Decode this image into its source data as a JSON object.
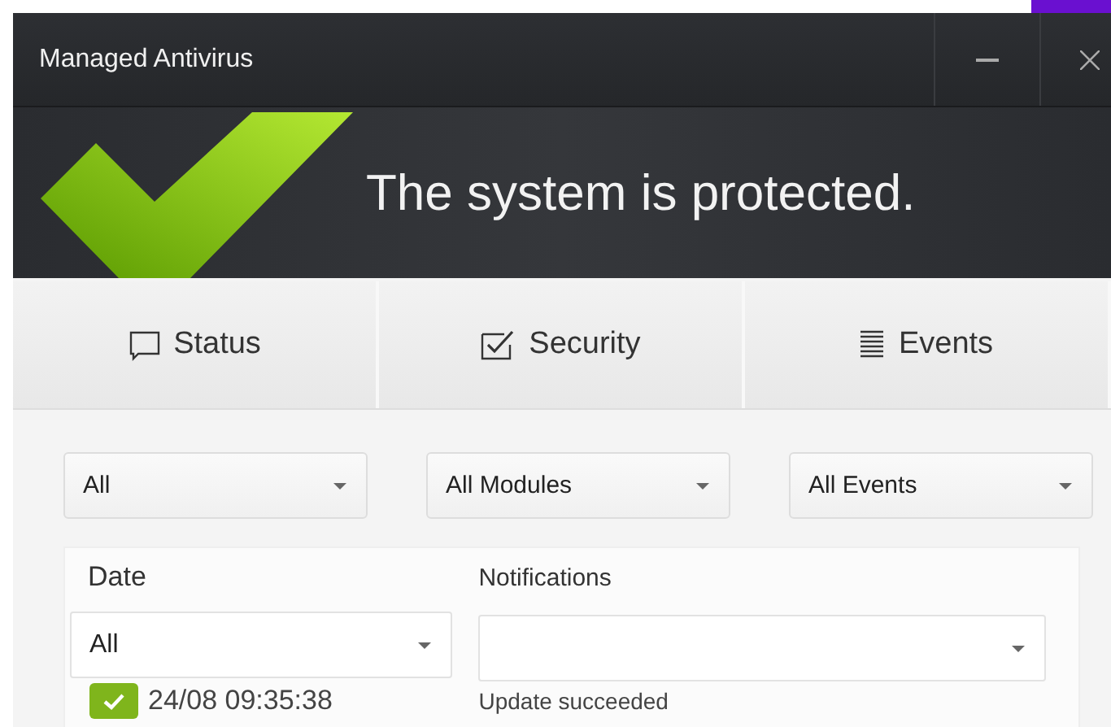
{
  "window": {
    "title": "Managed Antivirus",
    "controls": [
      {
        "kind": "minimize"
      },
      {
        "kind": "close"
      }
    ]
  },
  "banner": {
    "message": "The system is protected."
  },
  "tabs": [
    {
      "label": "Status",
      "kind": "message",
      "selected": false
    },
    {
      "label": "Security",
      "kind": "check",
      "selected": false
    },
    {
      "label": "Events",
      "kind": "list",
      "selected": false
    }
  ],
  "filters": [
    {
      "value": "All"
    },
    {
      "value": "All Modules"
    },
    {
      "value": "All Events"
    }
  ],
  "events": {
    "date_heading": "Date",
    "notifications_heading": "Notifications",
    "date_filter": {
      "value": "All"
    },
    "rows": [
      {
        "date": "24/08 09:35:38",
        "notification": "Update succeeded"
      }
    ]
  }
}
